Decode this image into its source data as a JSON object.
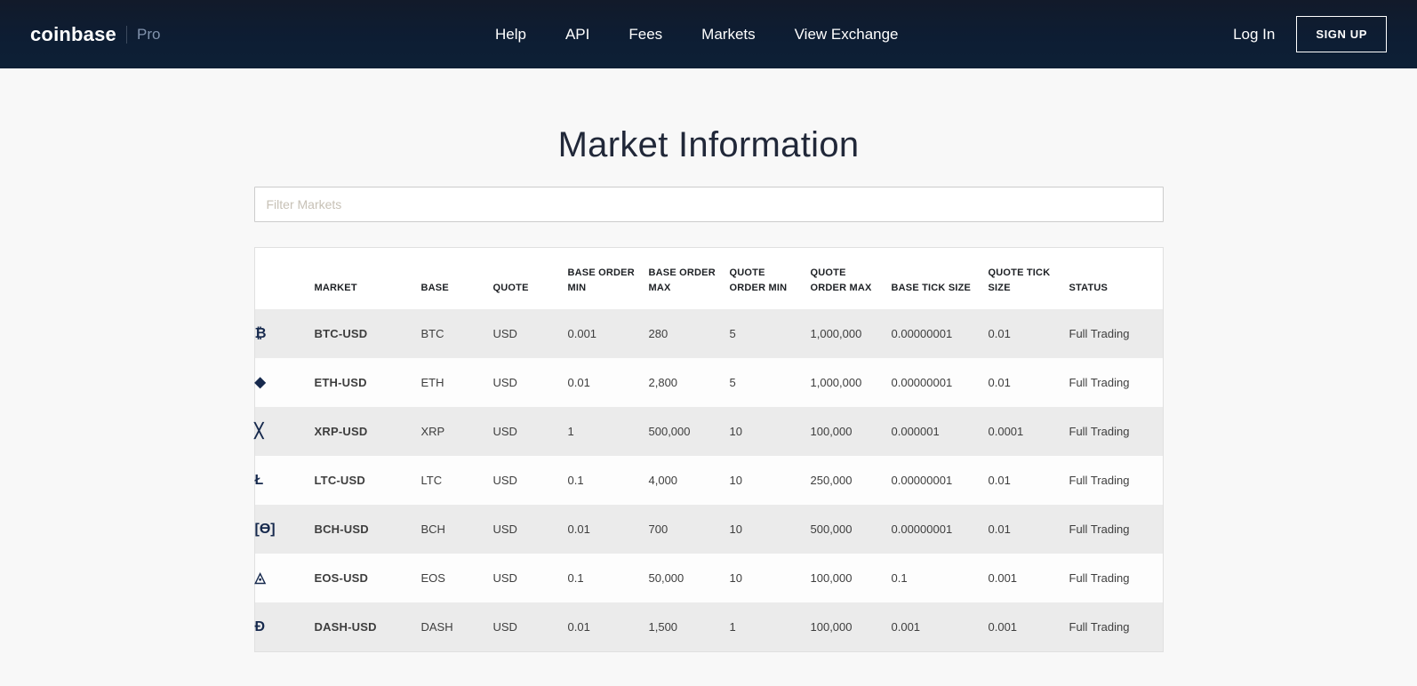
{
  "nav": {
    "logo": "coinbase",
    "logo_suffix": "Pro",
    "links": [
      "Help",
      "API",
      "Fees",
      "Markets",
      "View Exchange"
    ],
    "login_label": "Log In",
    "signup_label": "SIGN UP"
  },
  "page": {
    "title": "Market Information",
    "filter_placeholder": "Filter Markets"
  },
  "table": {
    "columns": [
      "",
      "MARKET",
      "BASE",
      "QUOTE",
      "BASE ORDER MIN",
      "BASE ORDER MAX",
      "QUOTE ORDER MIN",
      "QUOTE ORDER MAX",
      "BASE TICK SIZE",
      "QUOTE TICK SIZE",
      "STATUS"
    ],
    "rows": [
      {
        "icon": "₿",
        "icon_name": "btc-icon",
        "market": "BTC-USD",
        "base": "BTC",
        "quote": "USD",
        "base_order_min": "0.001",
        "base_order_max": "280",
        "quote_order_min": "5",
        "quote_order_max": "1,000,000",
        "base_tick_size": "0.00000001",
        "quote_tick_size": "0.01",
        "status": "Full Trading"
      },
      {
        "icon": "◆",
        "icon_name": "eth-icon",
        "market": "ETH-USD",
        "base": "ETH",
        "quote": "USD",
        "base_order_min": "0.01",
        "base_order_max": "2,800",
        "quote_order_min": "5",
        "quote_order_max": "1,000,000",
        "base_tick_size": "0.00000001",
        "quote_tick_size": "0.01",
        "status": "Full Trading"
      },
      {
        "icon": "╳",
        "icon_name": "xrp-icon",
        "market": "XRP-USD",
        "base": "XRP",
        "quote": "USD",
        "base_order_min": "1",
        "base_order_max": "500,000",
        "quote_order_min": "10",
        "quote_order_max": "100,000",
        "base_tick_size": "0.000001",
        "quote_tick_size": "0.0001",
        "status": "Full Trading"
      },
      {
        "icon": "Ł",
        "icon_name": "ltc-icon",
        "market": "LTC-USD",
        "base": "LTC",
        "quote": "USD",
        "base_order_min": "0.1",
        "base_order_max": "4,000",
        "quote_order_min": "10",
        "quote_order_max": "250,000",
        "base_tick_size": "0.00000001",
        "quote_tick_size": "0.01",
        "status": "Full Trading"
      },
      {
        "icon": "[Ɵ]",
        "icon_name": "bch-icon",
        "market": "BCH-USD",
        "base": "BCH",
        "quote": "USD",
        "base_order_min": "0.01",
        "base_order_max": "700",
        "quote_order_min": "10",
        "quote_order_max": "500,000",
        "base_tick_size": "0.00000001",
        "quote_tick_size": "0.01",
        "status": "Full Trading"
      },
      {
        "icon": "◬",
        "icon_name": "eos-icon",
        "market": "EOS-USD",
        "base": "EOS",
        "quote": "USD",
        "base_order_min": "0.1",
        "base_order_max": "50,000",
        "quote_order_min": "10",
        "quote_order_max": "100,000",
        "base_tick_size": "0.1",
        "quote_tick_size": "0.001",
        "status": "Full Trading"
      },
      {
        "icon": "Ɖ",
        "icon_name": "dash-icon",
        "market": "DASH-USD",
        "base": "DASH",
        "quote": "USD",
        "base_order_min": "0.01",
        "base_order_max": "1,500",
        "quote_order_min": "1",
        "quote_order_max": "100,000",
        "base_tick_size": "0.001",
        "quote_tick_size": "0.001",
        "status": "Full Trading"
      }
    ]
  },
  "colors": {
    "navbar_top": "#121a2a",
    "navbar_bottom": "#0d2036",
    "page_background": "#f8f8f8",
    "row_stripe": "#ebebeb",
    "icon_navy": "#16294d",
    "title_text": "#212839"
  }
}
